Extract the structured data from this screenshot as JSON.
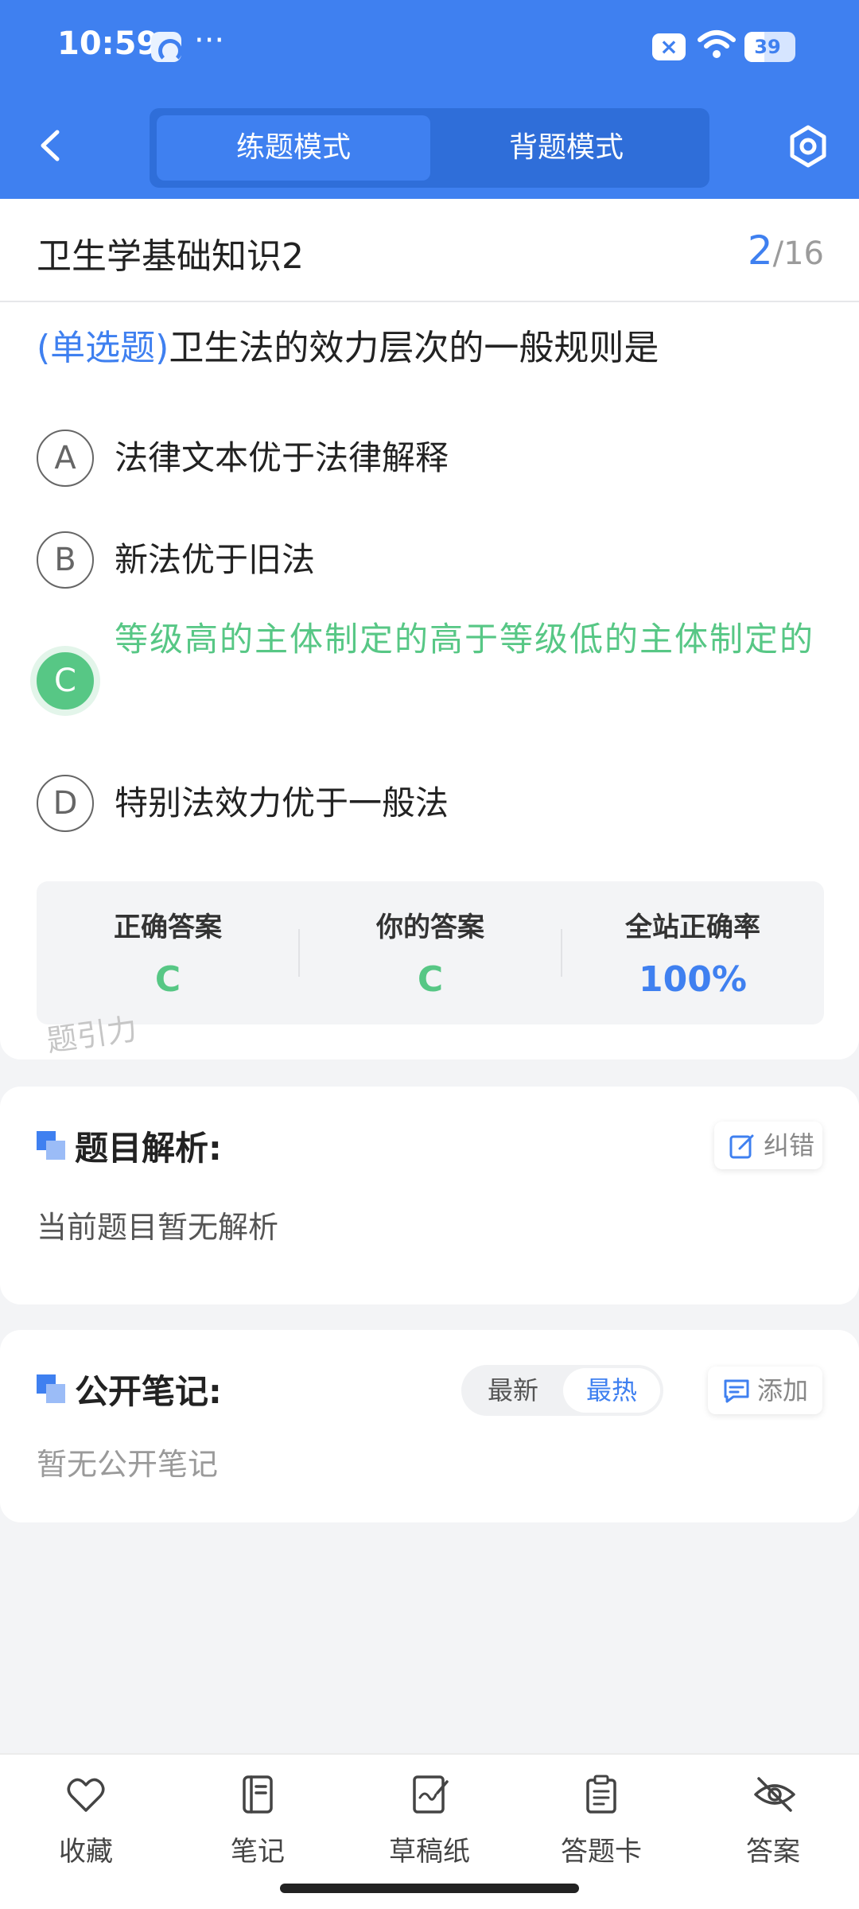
{
  "status_bar": {
    "time": "10:59",
    "more": "···",
    "battery": "39"
  },
  "header": {
    "tabs": [
      {
        "label": "练题模式",
        "active": true
      },
      {
        "label": "背题模式",
        "active": false
      }
    ]
  },
  "exam": {
    "title": "卫生学基础知识2",
    "current": "2",
    "total": "/16"
  },
  "question": {
    "type": "(单选题)",
    "text": "卫生法的效力层次的一般规则是",
    "options": [
      {
        "letter": "A",
        "text": "法律文本优于法律解释"
      },
      {
        "letter": "B",
        "text": "新法优于旧法"
      },
      {
        "letter": "C",
        "text": "等级高的主体制定的高于等级低的主体制定的",
        "correct": true
      },
      {
        "letter": "D",
        "text": "特别法效力优于一般法"
      }
    ]
  },
  "stats": {
    "correct_answer_label": "正确答案",
    "correct_answer": "C",
    "your_answer_label": "你的答案",
    "your_answer": "C",
    "accuracy_label": "全站正确率",
    "accuracy": "100%"
  },
  "watermark": "题引力",
  "analysis": {
    "title": "题目解析:",
    "body": "当前题目暂无解析",
    "report_label": "纠错"
  },
  "notes": {
    "title": "公开笔记:",
    "sort_latest": "最新",
    "sort_hot": "最热",
    "add_label": "添加",
    "empty": "暂无公开笔记"
  },
  "bottom_nav": {
    "items": [
      {
        "label": "收藏",
        "icon": "heart-icon"
      },
      {
        "label": "笔记",
        "icon": "notebook-icon"
      },
      {
        "label": "草稿纸",
        "icon": "scratch-paper-icon"
      },
      {
        "label": "答题卡",
        "icon": "answer-sheet-icon"
      },
      {
        "label": "答案",
        "icon": "eye-off-icon"
      }
    ]
  },
  "colors": {
    "primary": "#3f80f0",
    "correct": "#57c785"
  }
}
